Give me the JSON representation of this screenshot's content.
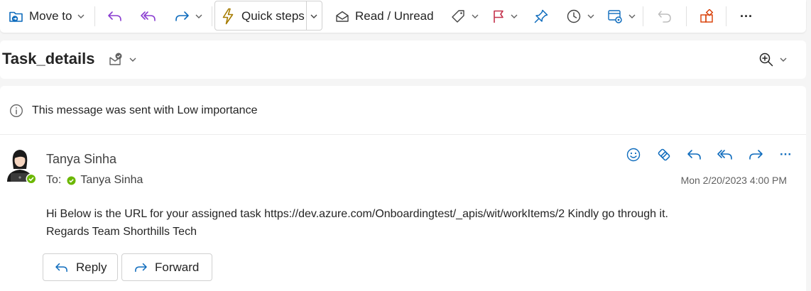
{
  "toolbar": {
    "move_to": "Move to",
    "quick_steps": "Quick steps",
    "read_unread": "Read / Unread",
    "more": "···"
  },
  "subject": "Task_details",
  "info_banner": "This message was sent with Low importance",
  "message": {
    "sender": "Tanya Sinha",
    "to_label": "To:",
    "recipient": "Tanya Sinha",
    "date": "Mon 2/20/2023 4:00 PM",
    "body_line1": "Hi Below is the URL for your assigned task https://dev.azure.com/Onboardingtest/_apis/wit/workItems/2 Kindly go through it.",
    "body_line2": "Regards Team Shorthills Tech",
    "more": "···"
  },
  "buttons": {
    "reply": "Reply",
    "forward": "Forward"
  },
  "colors": {
    "accent": "#0f6cbd",
    "purple": "#8a3dd1",
    "flag": "#c4314b",
    "quick_steps": "#a67c00",
    "apps": "#d83b01",
    "presence": "#6bb700"
  }
}
